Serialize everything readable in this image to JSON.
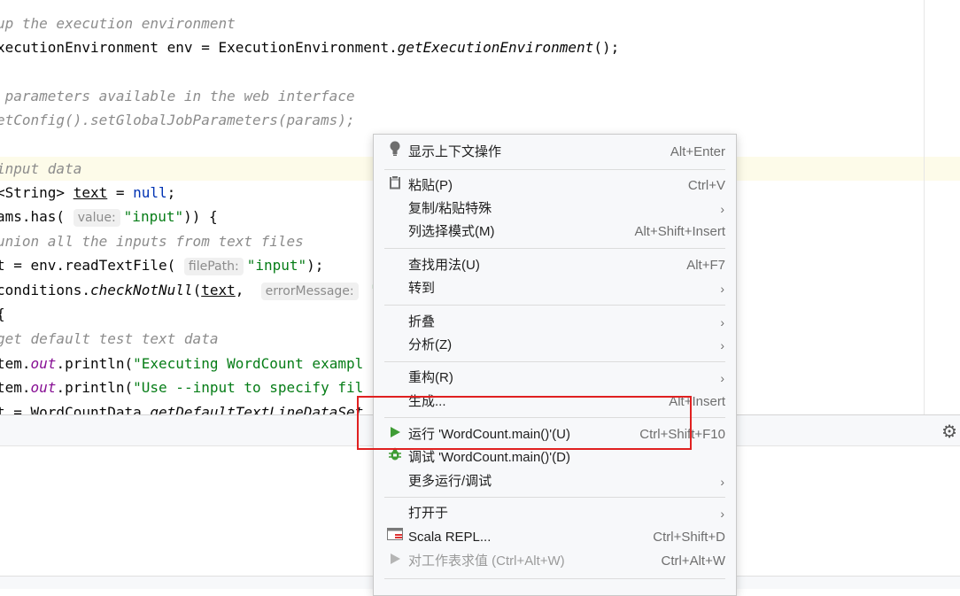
{
  "editor": {
    "lines": {
      "l1": "up the execution environment",
      "l2a": "xecutionEnvironment env = ExecutionEnvironment.",
      "l2b": "getExecutionEnvironment",
      "l2c": "();",
      "l4": " parameters available in the web interface",
      "l5": "etConfig().setGlobalJobParameters(params);",
      "l7": "input data",
      "l8a": "<String> ",
      "l8b": "text",
      "l8c": " = ",
      "l8d": "null",
      "l8e": ";",
      "l9a": "ams.has( ",
      "l9hint": "value:",
      "l9b": "\"input\"",
      "l9c": ")) {",
      "l10": "union all the inputs from text files",
      "l11a": "t = env.readTextFile( ",
      "l11hint": "filePath:",
      "l11b": "\"input\"",
      "l11c": ");",
      "l12a": "conditions.",
      "l12b": "checkNotNull",
      "l12c": "(",
      "l12d": "text",
      "l12e": ",  ",
      "l12hint": "errorMessage:",
      "l12f": " \"",
      "l13": "{",
      "l14": "get default test text data",
      "l15a": "tem.",
      "l15b": "out",
      "l15c": ".println(",
      "l15d": "\"Executing WordCount exampl",
      "l16a": "tem.",
      "l16b": "out",
      "l16c": ".println(",
      "l16d": "\"Use --input to specify fil",
      "l17a": "t = WordCountData.",
      "l17b": "getDefaultTextLineDataSet"
    }
  },
  "menu": {
    "items": [
      {
        "label": "显示上下文操作",
        "shortcut": "Alt+Enter",
        "icon": "lightbulb-icon"
      },
      {
        "label": "粘贴(P)",
        "shortcut": "Ctrl+V",
        "icon": "clipboard-icon"
      },
      {
        "label": "复制/粘贴特殊",
        "submenu": "›"
      },
      {
        "label": "列选择模式(M)",
        "shortcut": "Alt+Shift+Insert"
      },
      {
        "label": "查找用法(U)",
        "shortcut": "Alt+F7"
      },
      {
        "label": "转到",
        "submenu": "›"
      },
      {
        "label": "折叠",
        "submenu": "›"
      },
      {
        "label": "分析(Z)",
        "submenu": "›"
      },
      {
        "label": "重构(R)",
        "submenu": "›"
      },
      {
        "label": "生成...",
        "shortcut": "Alt+Insert"
      },
      {
        "label": "运行 'WordCount.main()'(U)",
        "shortcut": "Ctrl+Shift+F10",
        "icon": "run-icon",
        "color": "#3f9c35"
      },
      {
        "label": "调试 'WordCount.main()'(D)",
        "icon": "debug-icon"
      },
      {
        "label": "更多运行/调试",
        "submenu": "›"
      },
      {
        "label": "打开于",
        "submenu": "›"
      },
      {
        "label": "Scala REPL...",
        "shortcut": "Ctrl+Shift+D",
        "icon": "scala-repl-icon"
      },
      {
        "label": "对工作表求值 (Ctrl+Alt+W)",
        "shortcut": "Ctrl+Alt+W",
        "icon": "evaluate-icon",
        "disabled": true
      }
    ]
  },
  "highlight_color": "#e02020"
}
